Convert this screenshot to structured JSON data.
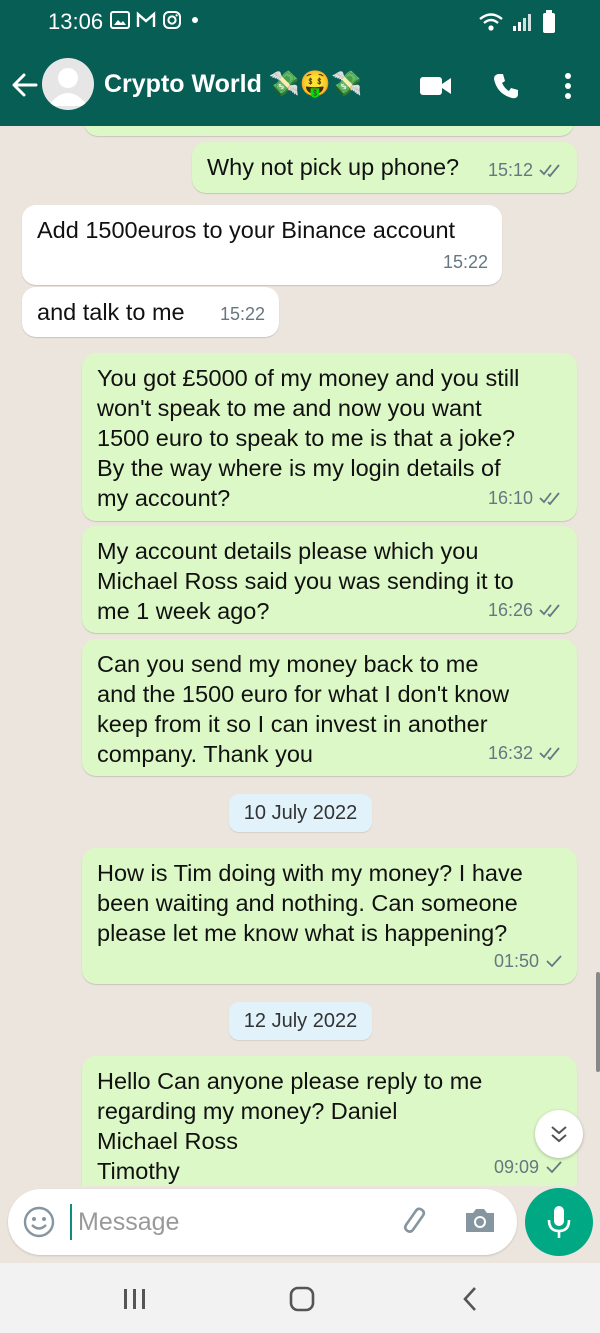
{
  "status_bar": {
    "time": "13:06",
    "notification_icons": [
      "gallery-icon",
      "gmail-icon",
      "instagram-icon",
      "dot-icon"
    ],
    "system_icons": [
      "wifi-icon",
      "signal-icon",
      "battery-icon"
    ]
  },
  "header": {
    "title": "Crypto World 💸🤑💸",
    "buttons": [
      "back",
      "video-call",
      "voice-call",
      "more-options"
    ]
  },
  "messages": [
    {
      "direction": "out",
      "lines": [
        "Why not pick up phone?"
      ],
      "time": "15:12",
      "ticks": "double"
    },
    {
      "direction": "in",
      "lines": [
        "Add 1500euros to your Binance account"
      ],
      "time": "15:22"
    },
    {
      "direction": "in",
      "lines": [
        "and talk to me"
      ],
      "time": "15:22"
    },
    {
      "direction": "out",
      "lines": [
        "You got £5000 of my money and you still",
        "won't speak to me and now you want",
        "1500 euro to speak to me is that a joke?",
        "By the way where is my login details of",
        "my account?"
      ],
      "time": "16:10",
      "ticks": "double"
    },
    {
      "direction": "out",
      "lines": [
        "My account details please which you",
        "Michael Ross said  you was sending it to",
        "me 1 week ago?"
      ],
      "time": "16:26",
      "ticks": "double"
    },
    {
      "direction": "out",
      "lines": [
        "Can you send my money back to me",
        "and the 1500 euro for what I don't know",
        "keep from it so I can invest in another",
        "company. Thank you"
      ],
      "time": "16:32",
      "ticks": "double"
    },
    {
      "direction": "out",
      "lines": [
        "How is Tim doing with my money? I have",
        "been waiting and nothing. Can someone",
        "please let me know what is happening?"
      ],
      "time": "01:50",
      "ticks": "single"
    },
    {
      "direction": "out",
      "lines": [
        "Hello Can anyone please reply to me",
        "regarding my money? Daniel",
        "Michael Ross",
        "Timothy"
      ],
      "time": "09:09",
      "ticks": "single"
    }
  ],
  "date_chips": [
    "10 July 2022",
    "12 July 2022"
  ],
  "composer": {
    "placeholder": "Message"
  },
  "colors": {
    "header": "#075e54",
    "outgoing_bubble": "#dcf8c6",
    "incoming_bubble": "#ffffff",
    "chat_bg": "#ece5dd",
    "accent": "#00a884",
    "tick_read": "#667781"
  },
  "nav_bar": {
    "buttons": [
      "recent-apps",
      "home",
      "back"
    ]
  }
}
